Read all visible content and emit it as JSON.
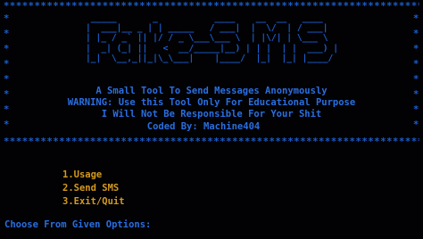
{
  "banner": {
    "border_line": "************************************************************************",
    "side_star": "*",
    "art": " _____       _           ____    __  __   ____\n|  ___|__ _ | | _____   / ___|  |  \\/  | / ___|\n| |_ / _` || |/ / _ \\___\\___ \\  | |\\/| | \\___ \\\n|  _| (_| ||   <  __/_____|__) | | |  | |  ___) |\n|_|  \\__,_||_|\\_\\___|    |____/  |_|  |_| |____/",
    "tagline": "A Small Tool To Send Messages Anonymously",
    "warning": "WARNING: Use this Tool Only For Educational Purpose",
    "disclaimer": "I Will Not Be Responsible For Your Shit",
    "credit": "Coded By: Machine404"
  },
  "menu": {
    "items": [
      {
        "label": "1.Usage"
      },
      {
        "label": "2.Send SMS"
      },
      {
        "label": "3.Exit/Quit"
      }
    ]
  },
  "prompt": {
    "text": "Choose From Given Options:"
  },
  "colors": {
    "background": "#020204",
    "banner_blue": "#1a5fd0",
    "text_blue": "#2a6ee0",
    "menu_orange": "#d49a1c"
  }
}
